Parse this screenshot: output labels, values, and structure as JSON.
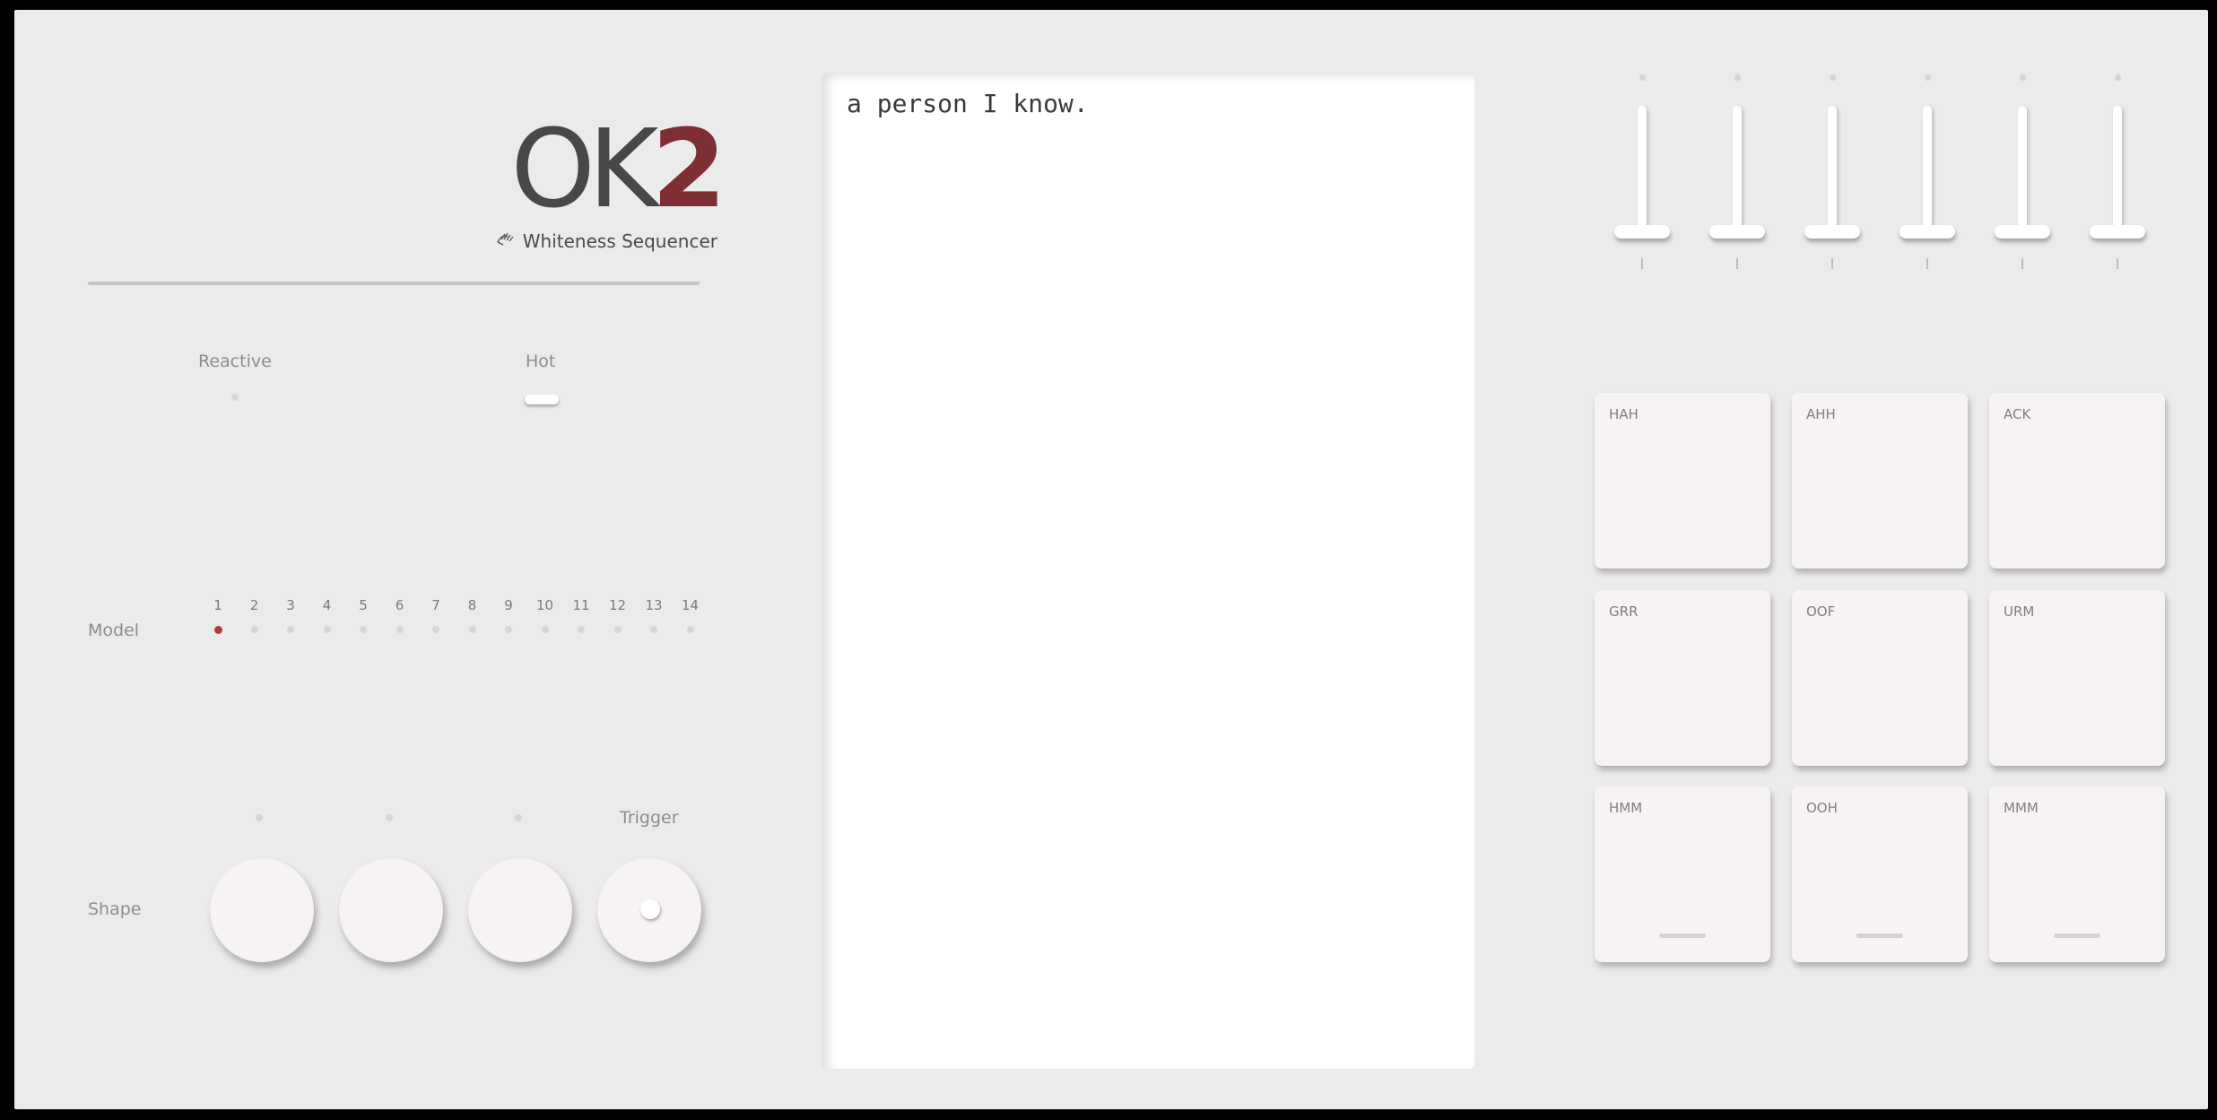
{
  "logo": {
    "ok": "OK",
    "two": "2",
    "hand_icon": "hand-icon",
    "subtitle": "Whiteness Sequencer"
  },
  "switches": {
    "reactive_label": "Reactive",
    "hot_label": "Hot"
  },
  "model": {
    "label": "Model",
    "numbers": [
      "1",
      "2",
      "3",
      "4",
      "5",
      "6",
      "7",
      "8",
      "9",
      "10",
      "11",
      "12",
      "13",
      "14"
    ],
    "selected": 1
  },
  "shape": {
    "label": "Shape",
    "trigger_label": "Trigger"
  },
  "text_panel": {
    "content": "a person I know."
  },
  "sliders": {
    "count": 6
  },
  "pads": [
    {
      "label": "HAH"
    },
    {
      "label": "AHH"
    },
    {
      "label": "ACK"
    },
    {
      "label": "GRR"
    },
    {
      "label": "OOF"
    },
    {
      "label": "URM"
    },
    {
      "label": "HMM"
    },
    {
      "label": "OOH"
    },
    {
      "label": "MMM"
    }
  ],
  "colors": {
    "accent": "#7e2f34",
    "led_on": "#b23a3a",
    "body": "#ebebeb"
  }
}
